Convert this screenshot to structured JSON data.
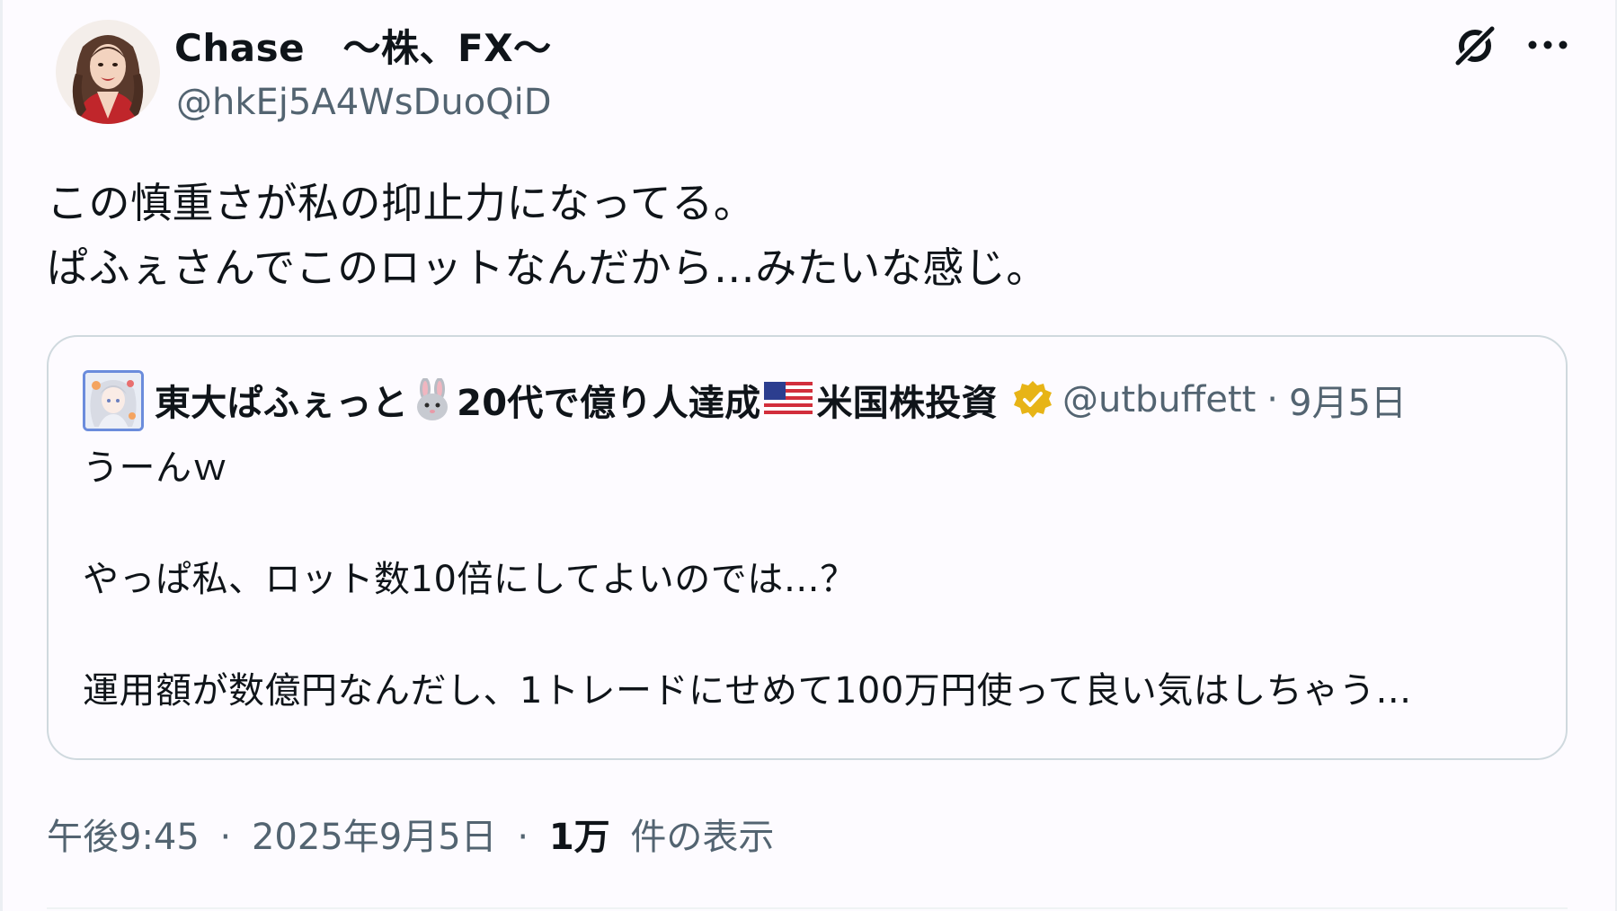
{
  "tweet": {
    "author": {
      "display_name": "Chase　～株、FX～",
      "handle": "@hkEj5A4WsDuoQiD",
      "avatar_icon": "user-avatar"
    },
    "text": "この慎重さが私の抑止力になってる。\nぱふぇさんでこのロットなんだから…みたいな感じ。",
    "actions": {
      "grok_icon": "grok-icon",
      "more_icon": "more-options-icon"
    },
    "quoted": {
      "name_part1": "東大ぱふぇっと",
      "name_part2": "20代で億り人達成",
      "name_part3": "米国株投資",
      "handle": "@utbuffett",
      "separator": "·",
      "date": "9月5日",
      "lines": [
        "うーんｗ",
        "",
        "やっぱ私、ロット数10倍にしてよいのでは…？",
        "",
        "運用額が数億円なんだし、1トレードにせめて100万円使って良い気はしちゃう…"
      ],
      "emoji": [
        "rabbit-emoji",
        "us-flag-emoji"
      ],
      "badge": "verified-badge",
      "badge_color": "#e7b416"
    },
    "meta": {
      "time": "午後9:45",
      "separator": "·",
      "date": "2025年9月5日",
      "views_count": "1万",
      "views_label": "件の表示"
    }
  },
  "colors": {
    "background": "#fdfbff",
    "text_primary": "#0f1419",
    "text_secondary": "#536471",
    "border": "#cfd9de"
  }
}
